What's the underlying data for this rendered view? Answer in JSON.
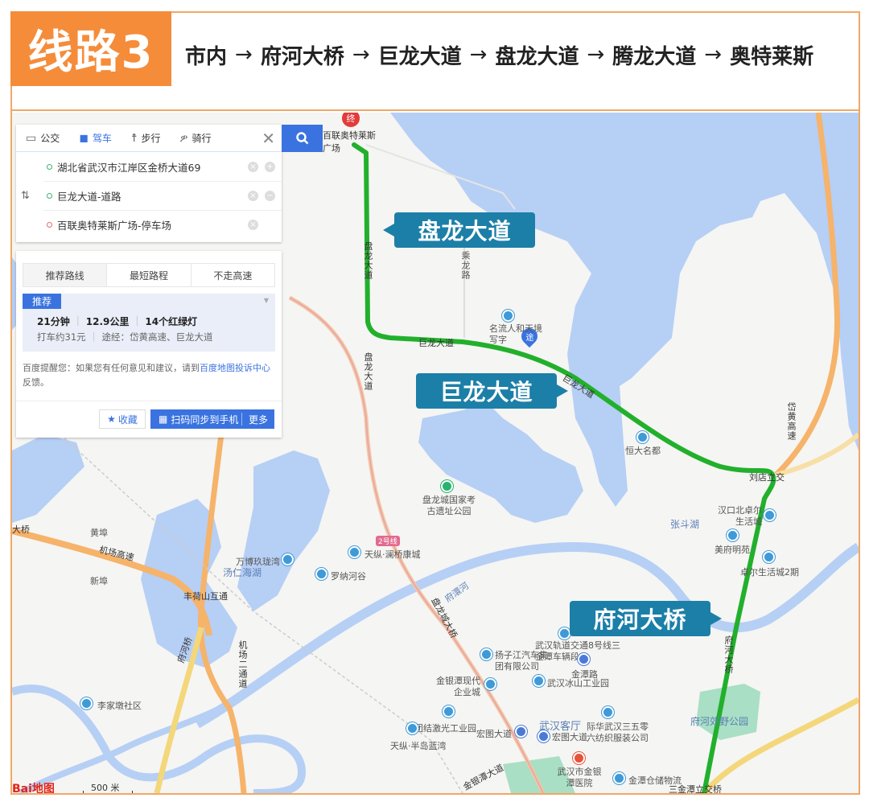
{
  "header": {
    "route_badge": "线路3",
    "route_stops": [
      "市内",
      "府河大桥",
      "巨龙大道",
      "盘龙大道",
      "腾龙大道",
      "奥特莱斯"
    ],
    "arrow": "→"
  },
  "colors": {
    "badge_orange": "#f58c3a",
    "frame_border": "#f0a867",
    "callout_blue": "#1c7fa8",
    "route_green": "#22b02c",
    "accent_blue": "#3a73e0",
    "water": "#b6cff5",
    "highway": "#f6b36a"
  },
  "panel": {
    "mode_tabs": [
      {
        "label": "公交",
        "icon": "bus-icon",
        "active": false
      },
      {
        "label": "驾车",
        "icon": "car-icon",
        "active": true
      },
      {
        "label": "步行",
        "icon": "walk-icon",
        "active": false
      },
      {
        "label": "骑行",
        "icon": "bike-icon",
        "active": false
      }
    ],
    "close_icon": "✕",
    "search_icon": "search-icon",
    "waypoints": [
      {
        "text": "湖北省武汉市江岸区金桥大道69",
        "type": "start"
      },
      {
        "text": "巨龙大道-道路",
        "type": "via"
      },
      {
        "text": "百联奥特莱斯广场-停车场",
        "type": "end"
      }
    ],
    "swap_icon": "⇅",
    "plan_tabs": [
      "推荐路线",
      "最短路程",
      "不走高速"
    ],
    "route_card": {
      "badge": "推荐",
      "duration": "21分钟",
      "distance": "12.9公里",
      "lights": "14个红绿灯",
      "taxi": "打车约31元",
      "via": "途经：岱黄高速、巨龙大道"
    },
    "notice_prefix": "百度提醒您：如果您有任何意见和建议，请到",
    "notice_link": "百度地图投诉中心",
    "notice_suffix": "反馈。",
    "favorite_label": "收藏",
    "sync_label": "扫码同步到手机",
    "more_label": "更多"
  },
  "map": {
    "callouts": {
      "panlong": "盘龙大道",
      "julong": "巨龙大道",
      "fuhe": "府河大桥"
    },
    "end_marker": "终",
    "via_marker": "途",
    "labels": {
      "bailian": "百联奥特莱斯广场",
      "panlong_road": "盘龙大道",
      "panlong_road2": "盘龙大道",
      "chenglong": "乘龙路",
      "julong_road": "巨龙大道",
      "julong_road2": "巨龙大道",
      "mingliu": "名流人和天境写字",
      "hengda": "恒大名都",
      "daihuang": "岱黄高速",
      "liudian": "刘店立交",
      "zhangdou": "张斗湖",
      "zhuoer1": "汉口北卓尔生活城",
      "meifu": "美府明苑",
      "zhuoer2": "卓尔生活城2期",
      "panlongcheng": "盘龙城国家考古遗址公园",
      "line2": "2号线",
      "tianzong": "天纵·澜桥康城",
      "luona": "罗纳河谷",
      "wanbo": "万博玖珑湾",
      "tangrenhai": "汤仁海湖",
      "huangwan": "黄埠",
      "jichang": "机场高速",
      "xinwan": "新埠",
      "fenghe": "丰荷山互通",
      "dajiao": "大桥",
      "fuhe_bridge_sw": "府河桥",
      "jichang2": "机场二通道",
      "lijia": "李家墩社区",
      "fuhuanhe": "府澴河",
      "panlong_bridge": "盘龙城大桥",
      "metro8": "武汉轨道交通8号线三金潭车辆段",
      "yangzijiang": "扬子江汽车集团有限公司",
      "jintan_rd": "金潭路",
      "bingshan": "武汉冰山工业园",
      "jinyintan_modern": "金银潭现代企业城",
      "tuanjie": "团结激光工业园",
      "bandao": "天纵·半岛蓝湾",
      "hongtu1": "宏图大道",
      "hongtu2": "宏图大道",
      "kefeng": "武汉客厅",
      "chenhua": "际华武汉三五零六纺织服装公司",
      "hospital": "武汉市金银潭医院",
      "jintan_storage": "金潭仓储物流",
      "jinyintan_ave": "金银潭大道",
      "fuhe_park": "府河郊野公园",
      "fuhe_bridge": "府河大桥",
      "sanjintan": "三金潭立交桥"
    },
    "logo": "Bai地图",
    "scale": "500 米"
  }
}
